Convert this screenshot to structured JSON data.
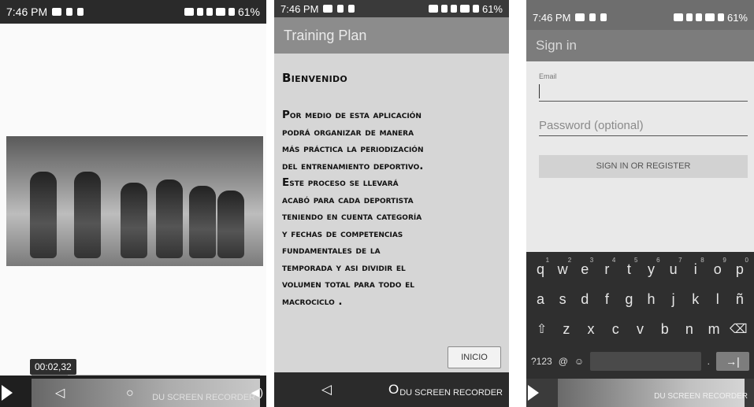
{
  "screens": [
    {
      "status_time": "7:46 PM",
      "battery": "61%",
      "video": {
        "time": "00:02,32",
        "progress_fraction": 0.16
      },
      "nav_back": "◁",
      "nav_home": "○",
      "recorder": "DU SCREEN RECORDER"
    },
    {
      "status_time": "7:46 PM",
      "battery": "61%",
      "title": "Training Plan",
      "welcome_heading": "Bienvenido",
      "welcome_body": "Por medio de esta aplicación\npodrá organizar de manera\nmás práctica la periodización\ndel entrenamiento deportivo.\n Este proceso se llevará\nacabó para cada deportista\nteniendo en cuenta  categoría\ny fechas de competencias\nfundamentales de la\ntemporada y asi dividir el\nvolumen total para todo el\nmacrociclo .",
      "inicio_button": "INICIO",
      "nav_back": "◁",
      "nav_home": "O",
      "recorder": "DU SCREEN RECORDER"
    },
    {
      "status_time": "7:46 PM",
      "battery": "61%",
      "title": "Sign in",
      "email_label": "Email",
      "password_placeholder": "Password (optional)",
      "signin_button": "SIGN IN OR REGISTER",
      "keyboard": {
        "row1": [
          "q",
          "w",
          "e",
          "r",
          "t",
          "y",
          "u",
          "i",
          "o",
          "p"
        ],
        "row1_nums": [
          "1",
          "2",
          "3",
          "4",
          "5",
          "6",
          "7",
          "8",
          "9",
          "0"
        ],
        "row2": [
          "a",
          "s",
          "d",
          "f",
          "g",
          "h",
          "j",
          "k",
          "l",
          "ñ"
        ],
        "row3": [
          "⇧",
          "z",
          "x",
          "c",
          "v",
          "b",
          "n",
          "m",
          "⌫"
        ],
        "bottom": {
          "sym": "?123",
          "at": "@",
          "emoji": "☺",
          "dot": ".",
          "enter": "→|"
        }
      },
      "recorder": "DU SCREEN RECORDER"
    }
  ]
}
